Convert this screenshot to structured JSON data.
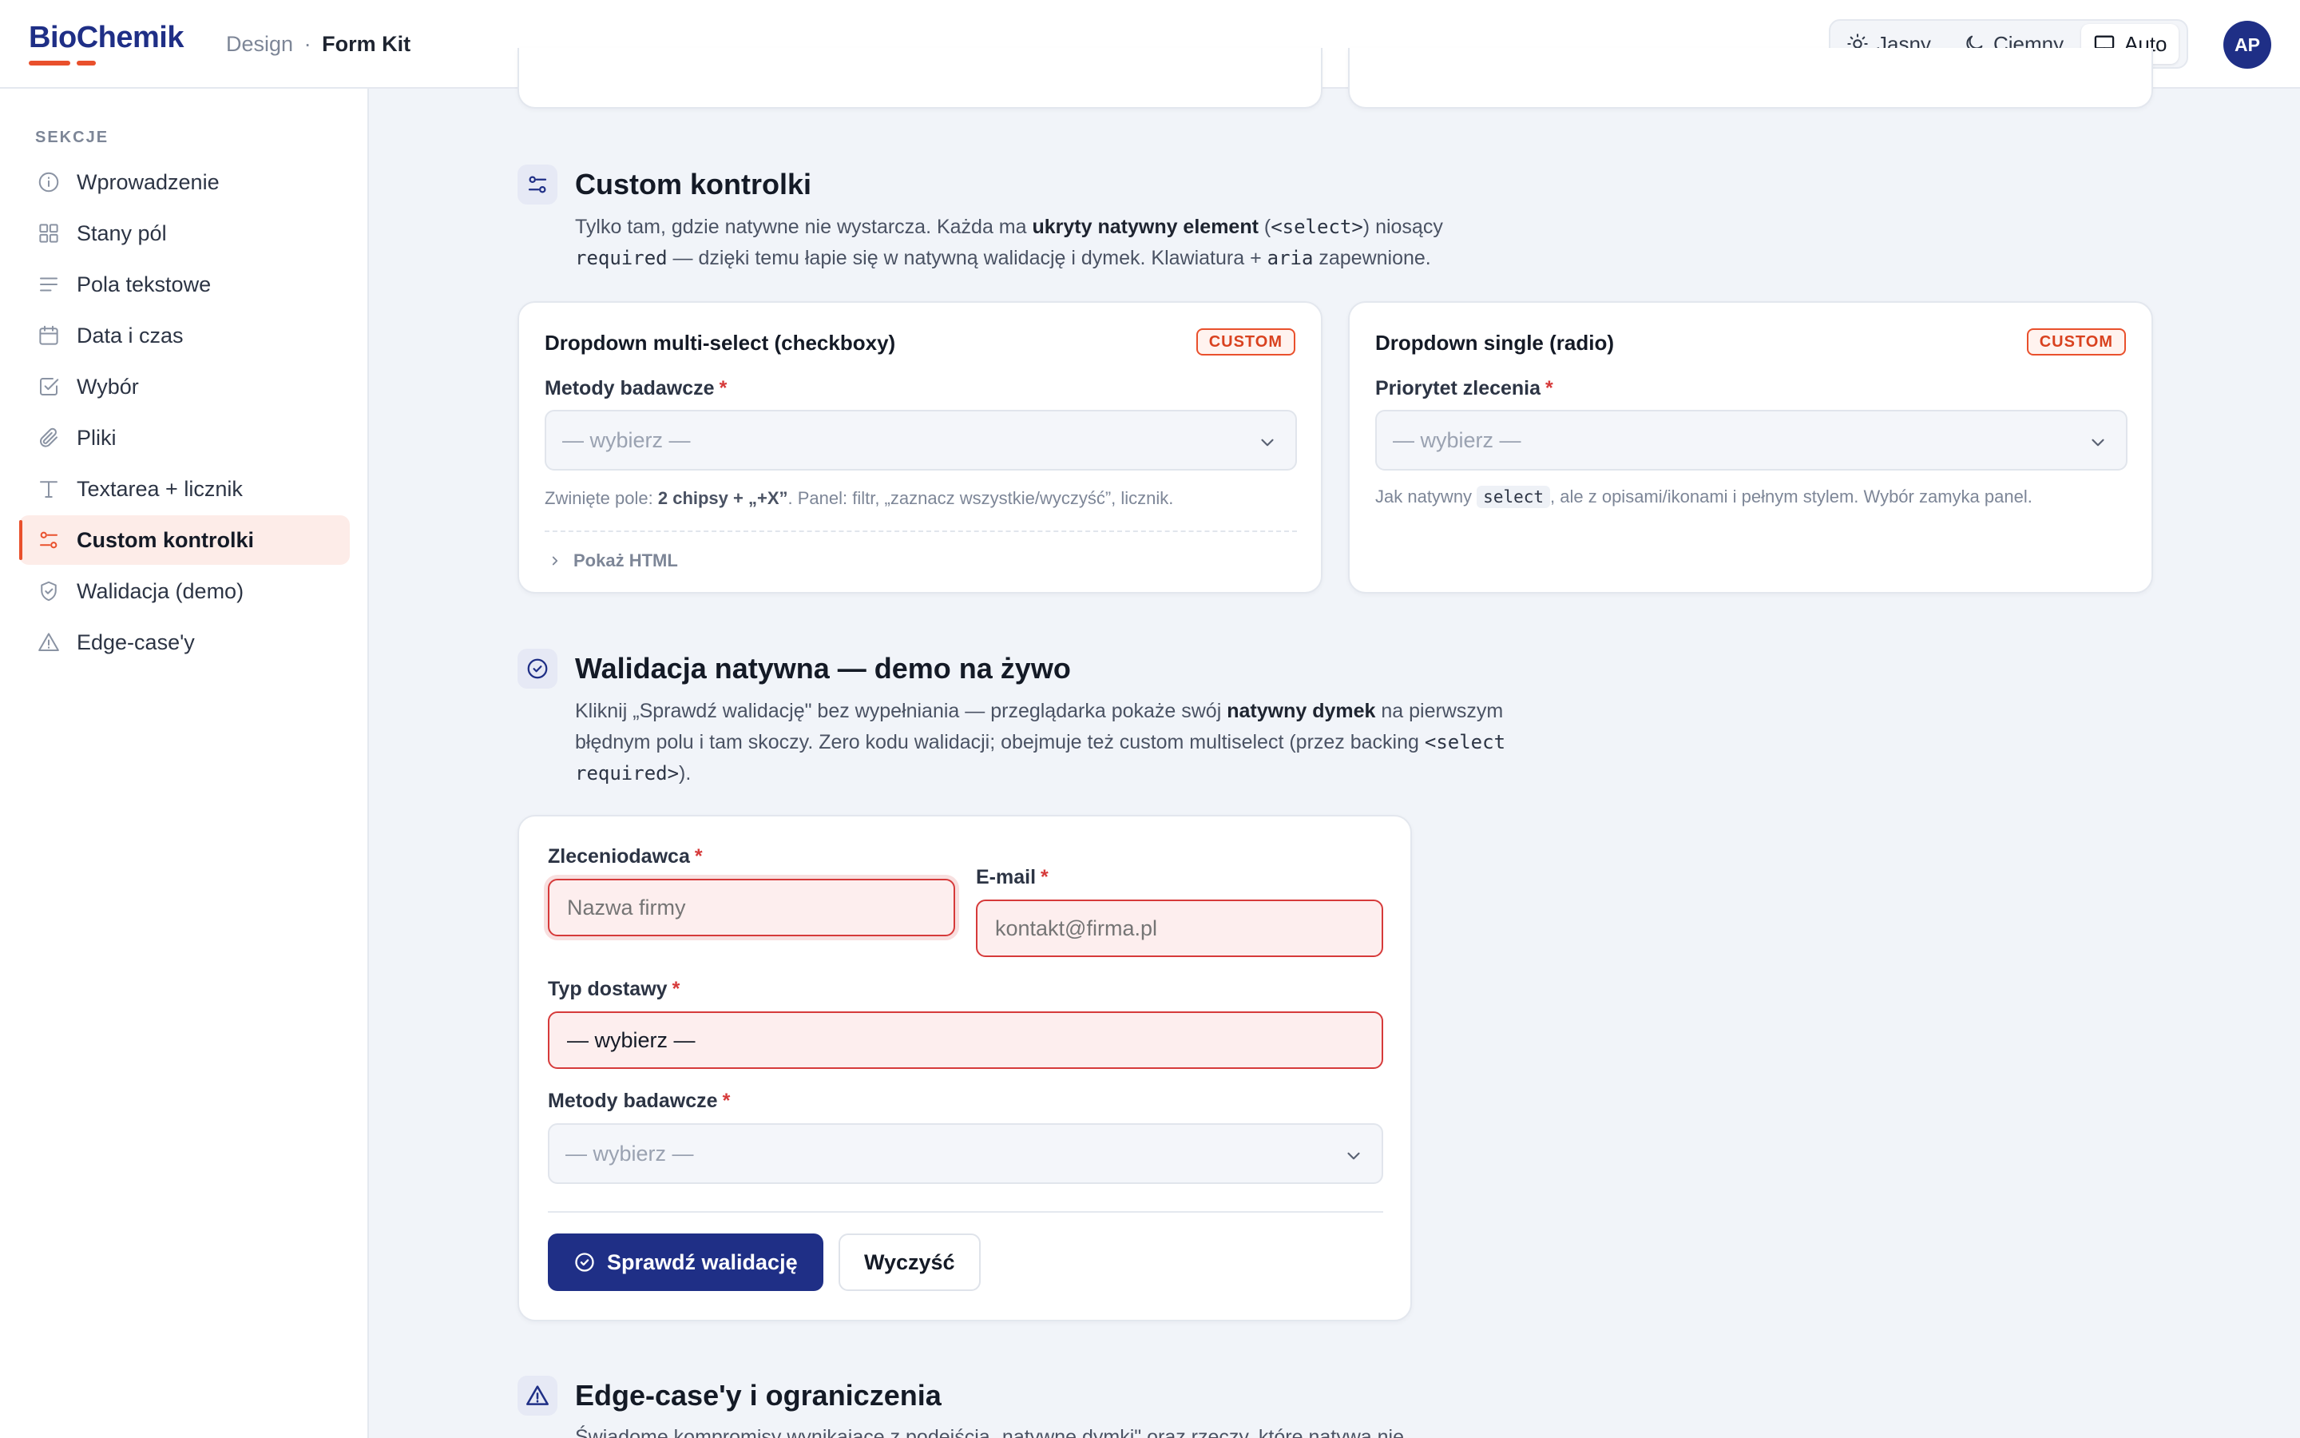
{
  "brand": {
    "name": "BioChemik",
    "accent": "#e9502c",
    "primary": "#1f2f86"
  },
  "breadcrumb": {
    "parent": "Design",
    "separator": "·",
    "current": "Form Kit"
  },
  "theme": {
    "options": [
      {
        "label": "Jasny",
        "icon": "sun-icon"
      },
      {
        "label": "Ciemny",
        "icon": "moon-icon"
      },
      {
        "label": "Auto",
        "icon": "monitor-icon",
        "active": true
      }
    ]
  },
  "user": {
    "initials": "AP"
  },
  "sidebar": {
    "title": "SEKCJE",
    "items": [
      {
        "label": "Wprowadzenie",
        "icon": "info-icon"
      },
      {
        "label": "Stany pól",
        "icon": "grid-icon"
      },
      {
        "label": "Pola tekstowe",
        "icon": "text-lines-icon"
      },
      {
        "label": "Data i czas",
        "icon": "calendar-icon"
      },
      {
        "label": "Wybór",
        "icon": "checkbox-icon"
      },
      {
        "label": "Pliki",
        "icon": "paperclip-icon"
      },
      {
        "label": "Textarea + licznik",
        "icon": "type-icon"
      },
      {
        "label": "Custom kontrolki",
        "icon": "sliders-icon",
        "active": true
      },
      {
        "label": "Walidacja (demo)",
        "icon": "shield-check-icon"
      },
      {
        "label": "Edge-case'y",
        "icon": "warning-icon"
      }
    ]
  },
  "custom": {
    "title": "Custom kontrolki",
    "desc_1": "Tylko tam, gdzie natywne nie wystarcza. Każda ma ",
    "desc_b1": "ukryty natywny element",
    "desc_2": " (",
    "desc_code1": "<select>",
    "desc_3": ") niosący",
    "desc_code2": "required",
    "desc_4": " — dzięki temu łapie się w natywną walidację i dymek. Klawiatura + ",
    "desc_code3": "aria",
    "desc_5": " zapewnione.",
    "multi": {
      "title": "Dropdown multi-select (checkboxy)",
      "badge": "CUSTOM",
      "label": "Metody badawcze",
      "placeholder": "— wybierz —",
      "hint_1": "Zwinięte pole: ",
      "hint_b": "2 chipsy + „+X”",
      "hint_2": ". Panel: filtr, „zaznacz wszystkie/wyczyść”, licznik.",
      "show_html": "Pokaż HTML"
    },
    "single": {
      "title": "Dropdown single (radio)",
      "badge": "CUSTOM",
      "label": "Priorytet zlecenia",
      "placeholder": "— wybierz —",
      "hint_1": "Jak natywny ",
      "hint_code": "select",
      "hint_2": ", ale z opisami/ikonami i pełnym stylem. Wybór zamyka panel."
    }
  },
  "validation": {
    "title": "Walidacja natywna — demo na żywo",
    "desc_1": "Kliknij „Sprawdź walidację\" bez wypełniania — przeglądarka pokaże swój ",
    "desc_b": "natywny dymek",
    "desc_2": " na pierwszym błędnym polu i tam skoczy. Zero kodu walidacji; obejmuje też custom multiselect (przez backing ",
    "desc_code": "<select required>",
    "desc_3": ").",
    "client_label": "Zleceniodawca",
    "client_placeholder": "Nazwa firmy",
    "email_label": "E-mail",
    "email_placeholder": "kontakt@firma.pl",
    "delivery_label": "Typ dostawy",
    "delivery_value": "— wybierz —",
    "methods_label": "Metody badawcze",
    "methods_placeholder": "— wybierz —",
    "check_button": "Sprawdź walidację",
    "clear_button": "Wyczyść",
    "required_mark": "*"
  },
  "edge": {
    "title": "Edge-case'y i ograniczenia",
    "desc": "Świadome kompromisy wynikające z podejścia „natywne dymki\" oraz rzeczy, które natywa nie"
  }
}
